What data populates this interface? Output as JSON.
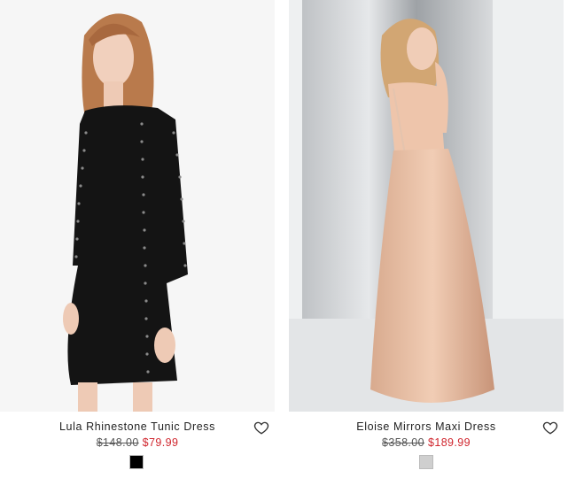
{
  "products": [
    {
      "name": "Lula Rhinestone Tunic Dress",
      "old_price": "$148.00",
      "sale_price": "$79.99",
      "swatch_color": "#000000",
      "wishlist_icon": "heart-outline-icon"
    },
    {
      "name": "Eloise Mirrors Maxi Dress",
      "old_price": "$358.00",
      "sale_price": "$189.99",
      "swatch_color": "#cfcfcf",
      "wishlist_icon": "heart-outline-icon"
    }
  ],
  "colors": {
    "sale": "#d0262e",
    "text": "#222222"
  }
}
